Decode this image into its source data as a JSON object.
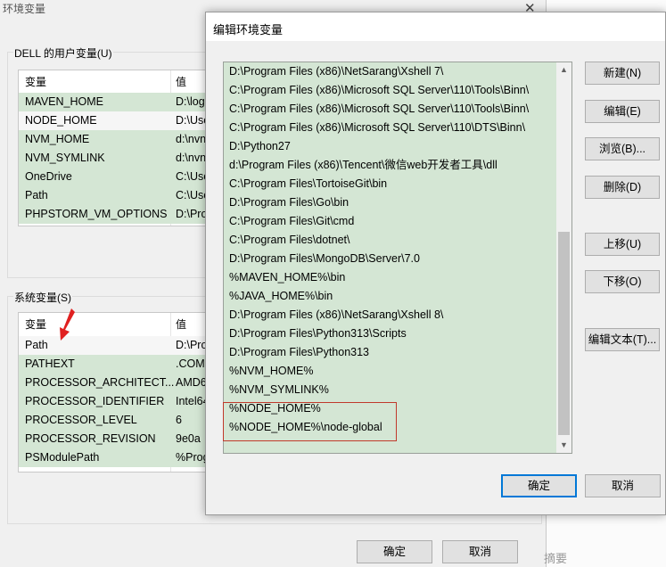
{
  "background_window": {
    "title": "环境变量",
    "close_glyph": "✕",
    "user_vars_label": "DELL 的用户变量(U)",
    "system_vars_label": "系统变量(S)",
    "col_variable": "变量",
    "col_value": "值",
    "user_vars": [
      {
        "name": "MAVEN_HOME",
        "value": "D:\\log"
      },
      {
        "name": "NODE_HOME",
        "value": "D:\\Use"
      },
      {
        "name": "NVM_HOME",
        "value": "d:\\nvn"
      },
      {
        "name": "NVM_SYMLINK",
        "value": "d:\\nvn"
      },
      {
        "name": "OneDrive",
        "value": "C:\\Use"
      },
      {
        "name": "Path",
        "value": "C:\\Use"
      },
      {
        "name": "PHPSTORM_VM_OPTIONS",
        "value": "D:\\Pro"
      }
    ],
    "system_vars": [
      {
        "name": "Path",
        "value": "D:\\Pro"
      },
      {
        "name": "PATHEXT",
        "value": ".COM;"
      },
      {
        "name": "PROCESSOR_ARCHITECT...",
        "value": "AMD6"
      },
      {
        "name": "PROCESSOR_IDENTIFIER",
        "value": "Intel64"
      },
      {
        "name": "PROCESSOR_LEVEL",
        "value": "6"
      },
      {
        "name": "PROCESSOR_REVISION",
        "value": "9e0a"
      },
      {
        "name": "PSModulePath",
        "value": "%Prog"
      }
    ],
    "ok_label": "确定",
    "cancel_label": "取消",
    "partial_text": "摘要"
  },
  "dialog": {
    "title": "编辑环境变量",
    "paths": [
      "D:\\Program Files (x86)\\NetSarang\\Xshell 7\\",
      "C:\\Program Files (x86)\\Microsoft SQL Server\\110\\Tools\\Binn\\",
      "C:\\Program Files (x86)\\Microsoft SQL Server\\110\\Tools\\Binn\\",
      "C:\\Program Files (x86)\\Microsoft SQL Server\\110\\DTS\\Binn\\",
      "D:\\Python27",
      "d:\\Program Files (x86)\\Tencent\\微信web开发者工具\\dll",
      "C:\\Program Files\\TortoiseGit\\bin",
      "D:\\Program Files\\Go\\bin",
      "C:\\Program Files\\Git\\cmd",
      "C:\\Program Files\\dotnet\\",
      "D:\\Program Files\\MongoDB\\Server\\7.0",
      "%MAVEN_HOME%\\bin",
      "%JAVA_HOME%\\bin",
      "D:\\Program Files (x86)\\NetSarang\\Xshell 8\\",
      "D:\\Program Files\\Python313\\Scripts",
      "D:\\Program Files\\Python313",
      "%NVM_HOME%",
      "%NVM_SYMLINK%",
      "%NODE_HOME%",
      "%NODE_HOME%\\node-global"
    ],
    "buttons": {
      "new": "新建(N)",
      "edit": "编辑(E)",
      "browse": "浏览(B)...",
      "delete": "删除(D)",
      "move_up": "上移(U)",
      "move_down": "下移(O)",
      "edit_text": "编辑文本(T)...",
      "ok": "确定",
      "cancel": "取消"
    },
    "scroll_up_glyph": "▲",
    "scroll_down_glyph": "▼"
  },
  "colors": {
    "selected_row": "#d4e6d4",
    "highlight_border": "#c0392b",
    "primary_button_border": "#0078d7"
  }
}
